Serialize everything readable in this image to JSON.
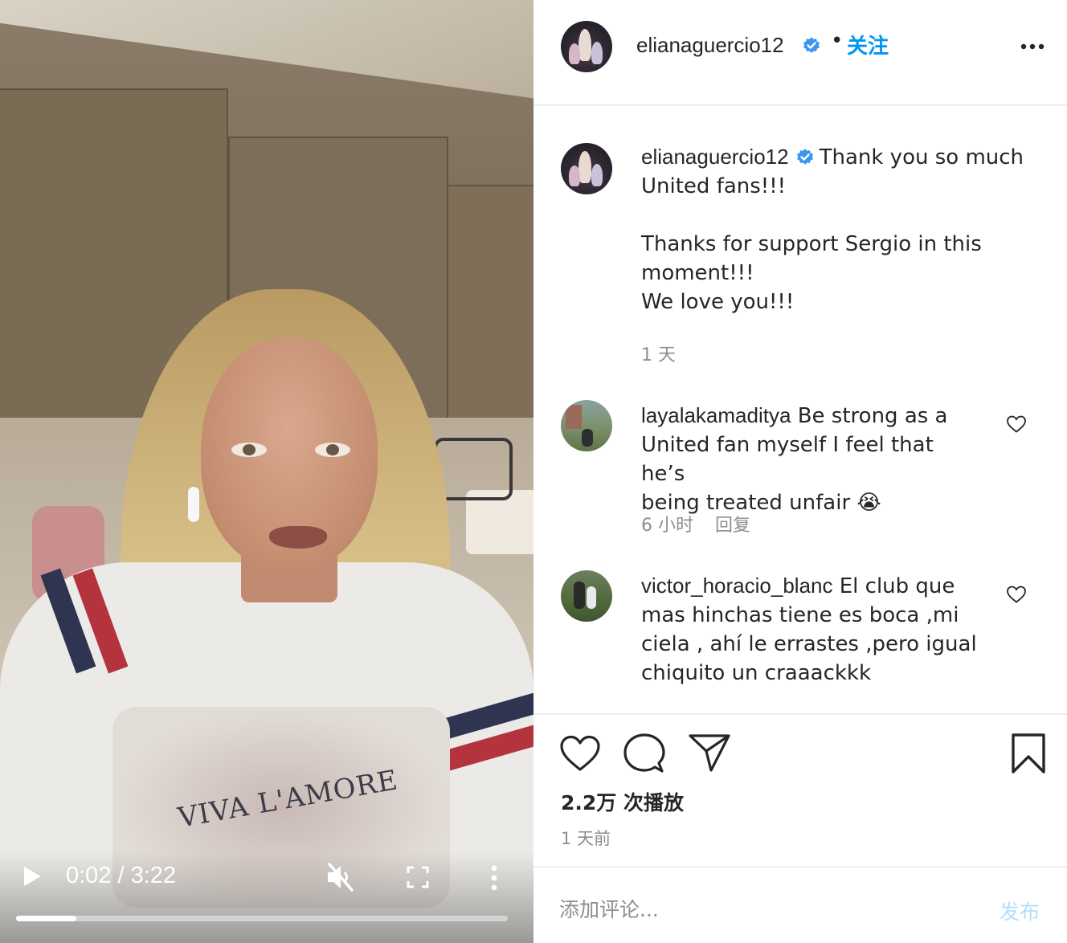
{
  "video": {
    "shirt_print_text": "VIVA L'AMORE",
    "current_time": "0:02",
    "duration": "3:22",
    "time_display": "0:02 / 3:22",
    "progress_fraction": 0.122,
    "muted": true,
    "icons": {
      "play": "play-icon",
      "mute": "volume-muted-icon",
      "fullscreen": "fullscreen-icon",
      "more": "more-vertical-icon"
    }
  },
  "header": {
    "username": "elianaguercio12",
    "verified": true,
    "separator": "•",
    "follow_label": "关注",
    "more_icon": "more-horizontal-icon"
  },
  "caption": {
    "username": "elianaguercio12",
    "line1": "Thank you so much",
    "line2": "United fans!!!",
    "line3": "Thanks for support Sergio in this",
    "line4": "moment!!!",
    "line5": "We love you!!!",
    "time": "1 天"
  },
  "comments": [
    {
      "username": "layalakamaditya",
      "text_line1": "Be strong as a",
      "text_line2": "United fan myself I feel that he’s",
      "text_line3": "being treated unfair",
      "emoji": "😭",
      "time": "6 小时",
      "reply_label": "回复"
    },
    {
      "username": "victor_horacio_blanc",
      "text_line1": "El club que",
      "text_line2": "mas hinchas tiene es boca ,mi",
      "text_line3": "ciela , ahí le errastes ,pero igual",
      "text_line4": "chiquito un craaackkk"
    }
  ],
  "actions": {
    "icons": [
      "heart-icon",
      "comment-icon",
      "share-icon",
      "bookmark-icon"
    ],
    "plays": "2.2万 次播放",
    "posted": "1 天前"
  },
  "composer": {
    "placeholder": "添加评论...",
    "post_label": "发布"
  },
  "colors": {
    "accent_blue": "#0095f6",
    "post_button_disabled": "#b2dffc",
    "verified_blue": "#3897f0",
    "muted_text": "#8e8e8e"
  }
}
